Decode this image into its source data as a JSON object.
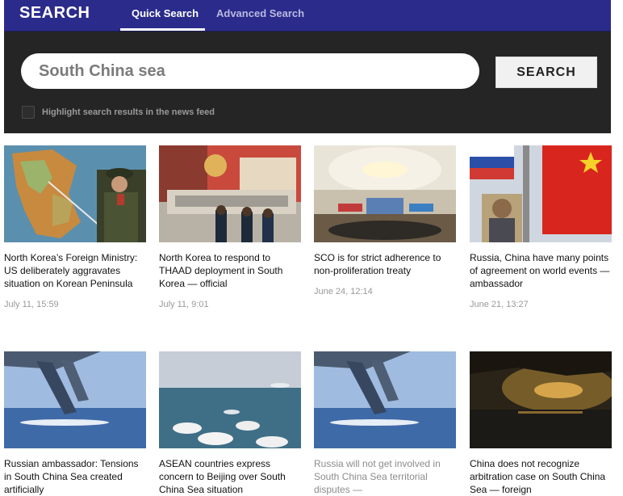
{
  "header": {
    "brand": "SEARCH",
    "tabs": [
      {
        "label": "Quick Search"
      },
      {
        "label": "Advanced Search"
      }
    ]
  },
  "search": {
    "value": "South China sea",
    "button_label": "SEARCH",
    "highlight_label": "Highlight search results in the news feed"
  },
  "articles": [
    {
      "title": "North Korea’s Foreign Ministry: US deliberately aggravates situation on Korean Peninsula",
      "date": "July 11, 15:59",
      "image": "map-officer"
    },
    {
      "title": "North Korea to respond to THAAD deployment in South Korea — official",
      "date": "July 11, 9:01",
      "image": "mural"
    },
    {
      "title": "SCO is for strict adherence to non-proliferation treaty",
      "date": "June 24, 12:14",
      "image": "conference-hall"
    },
    {
      "title": "Russia, China have many points of agreement on world events — ambassador",
      "date": "June 21, 13:27",
      "image": "flags"
    },
    {
      "title": "Russian ambassador: Tensions in South China Sea created artificially",
      "date": "",
      "image": "aircraft-island"
    },
    {
      "title": "ASEAN countries express concern to Beijing over South China Sea situation",
      "date": "",
      "image": "reef-clouds"
    },
    {
      "title": "Russia will not get involved in South China Sea territorial disputes —",
      "date": "",
      "image": "aircraft-island"
    },
    {
      "title": "China does not recognize arbitration case on South China Sea — foreign",
      "date": "",
      "image": "sunset-sea"
    }
  ]
}
